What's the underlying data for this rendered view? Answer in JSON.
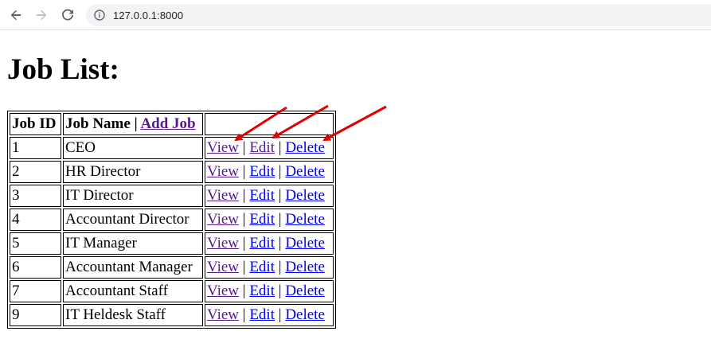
{
  "browser": {
    "url": "127.0.0.1:8000",
    "back_icon": "arrow-left-icon",
    "forward_icon": "arrow-right-icon",
    "reload_icon": "reload-icon",
    "info_icon": "info-circle-icon"
  },
  "page": {
    "title": "Job List:"
  },
  "table": {
    "headers": {
      "id": "Job ID",
      "name": "Job Name |",
      "add_link": "Add Job"
    },
    "actions": {
      "view": "View",
      "edit": "Edit",
      "delete": "Delete",
      "separator": "|"
    },
    "rows": [
      {
        "id": "1",
        "name": "CEO"
      },
      {
        "id": "2",
        "name": "HR Director"
      },
      {
        "id": "3",
        "name": "IT Director"
      },
      {
        "id": "4",
        "name": "Accountant Director"
      },
      {
        "id": "5",
        "name": "IT Manager"
      },
      {
        "id": "6",
        "name": "Accountant Manager"
      },
      {
        "id": "7",
        "name": "Accountant Staff"
      },
      {
        "id": "9",
        "name": "IT Heldesk Staff"
      }
    ]
  },
  "colors": {
    "link": "#0000ee",
    "visited_link": "#551a8b",
    "annotation_arrow": "#e00000"
  }
}
